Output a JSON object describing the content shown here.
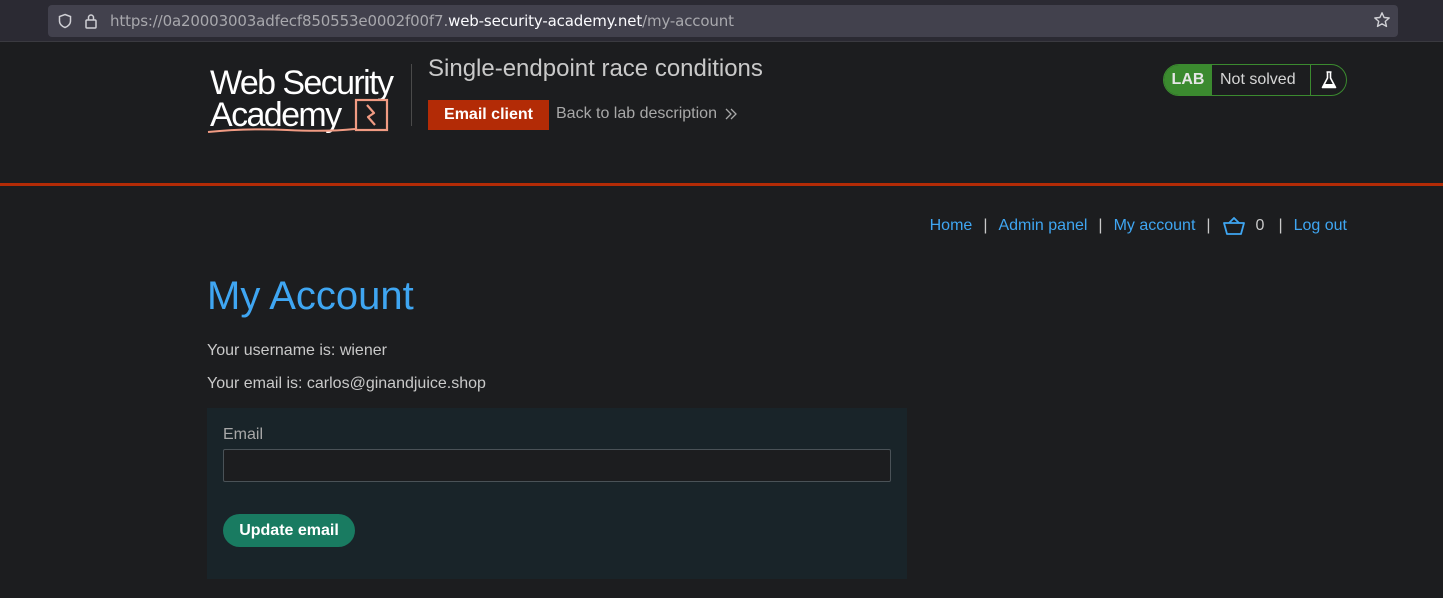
{
  "browser": {
    "url_prefix": "https://0a20003003adfecf850553e0002f00f7.",
    "url_domain": "web-security-academy.net",
    "url_path": "/my-account"
  },
  "header": {
    "logo_line1": "Web Security",
    "logo_line2": "Academy",
    "lab_title": "Single-endpoint race conditions",
    "email_client_label": "Email client",
    "back_link_label": "Back to lab description",
    "lab_badge": "LAB",
    "lab_status": "Not solved",
    "accent_color": "#b32b06",
    "status_color": "#3b8a2f"
  },
  "nav": {
    "home": "Home",
    "admin_panel": "Admin panel",
    "my_account": "My account",
    "cart_count": "0",
    "log_out": "Log out",
    "separator": "|",
    "link_color": "#3fa6f2"
  },
  "main": {
    "title": "My Account",
    "username_line": "Your username is: wiener",
    "email_line": "Your email is: carlos@ginandjuice.shop",
    "form": {
      "email_label": "Email",
      "email_value": "",
      "update_button": "Update email",
      "button_color": "#197b61"
    }
  }
}
